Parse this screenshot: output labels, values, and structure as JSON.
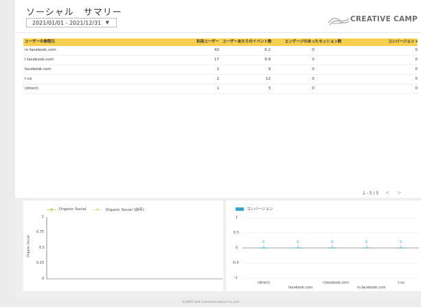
{
  "header": {
    "title": "ソーシャル　サマリー",
    "date_range": "2021/01/01 - 2021/12/31",
    "logo_text": "CREATIVE CAMP"
  },
  "table": {
    "columns": [
      "ユーザーの参照元",
      "利用ユーザー",
      "ユーザーあたりのイベント数",
      "エンゲージのあったセッション数",
      "コンバージョン ▾"
    ],
    "rows": [
      [
        "m.facebook.com",
        "43",
        "6.2",
        "0",
        "0"
      ],
      [
        "l.facebook.com",
        "17",
        "9.9",
        "0",
        "0"
      ],
      [
        "facebook.com",
        "2",
        "9",
        "0",
        "0"
      ],
      [
        "t.co",
        "2",
        "12",
        "0",
        "0"
      ],
      [
        "(direct)",
        "1",
        "3",
        "0",
        "0"
      ]
    ],
    "header_color": "#f7cf4f",
    "pagination": "1 - 5 / 5",
    "prev_icon": "chevron-left-icon",
    "next_icon": "chevron-right-icon"
  },
  "chart_data": [
    {
      "type": "line",
      "series": [
        {
          "name": "Organic Social",
          "values": [],
          "color": "#c9d66b"
        },
        {
          "name": "Organic Social (前年)",
          "values": [],
          "color": "#dde8a8"
        }
      ],
      "ylabel": "Organic Social",
      "yticks": [
        "1",
        "0.75",
        "0.5",
        "0.25",
        "0"
      ],
      "ylim": [
        0,
        1
      ],
      "legend": "top",
      "grid": false
    },
    {
      "type": "bar",
      "series": [
        {
          "name": "コンバージョン",
          "values": [
            0,
            0,
            0,
            0,
            0
          ],
          "color": "#36a3c9"
        }
      ],
      "categories": [
        "(direct)",
        "facebook.com",
        "l.facebook.com",
        "m.facebook.com",
        "t.co"
      ],
      "data_labels": [
        "0",
        "0",
        "0",
        "0",
        "0"
      ],
      "yticks": [
        "1",
        "0.5",
        "0",
        "-0.5",
        "-1"
      ],
      "ylim": [
        -1,
        1
      ],
      "legend": "top-left",
      "grid": true
    }
  ],
  "footer": {
    "text": "©2005 Soft Communications Co.,Ltd"
  }
}
